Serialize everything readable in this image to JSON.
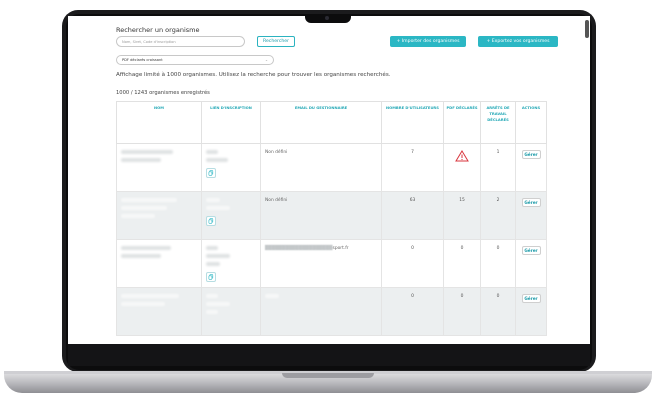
{
  "search": {
    "title": "Rechercher un organisme",
    "placeholder": "Nom, Siret, Code d'inscription",
    "button_label": "Rechercher"
  },
  "actions": {
    "import_label": "+ Importer des organismes",
    "export_label": "+ Exportez vos organismes"
  },
  "sort": {
    "selected": "PDF déclarés croissant"
  },
  "notice": "Affichage limité à 1000 organismes. Utilisez la recherche pour trouver les organismes recherchés.",
  "count": "1000 / 1243 organismes enregistrés",
  "table": {
    "headers": [
      "NOM",
      "LIEN D'INSCRIPTION",
      "EMAIL DU GESTIONNAIRE",
      "NOMBRE D'UTILISATEURS",
      "PDF DÉCLARÉS",
      "ARRÊTS DE TRAVAIL DÉCLARÉS",
      "ACTIONS"
    ],
    "rows": [
      {
        "email": "Non défini",
        "users": "7",
        "pdf": "",
        "pdf_warning": true,
        "arrets": "1",
        "action": "Gérer"
      },
      {
        "email": "Non défini",
        "users": "63",
        "pdf": "15",
        "pdf_warning": false,
        "arrets": "2",
        "action": "Gérer"
      },
      {
        "email": "sport.fr",
        "users": "0",
        "pdf": "0",
        "pdf_warning": false,
        "arrets": "0",
        "action": "Gérer"
      },
      {
        "email": "",
        "users": "0",
        "pdf": "0",
        "pdf_warning": false,
        "arrets": "0",
        "action": "Gérer"
      }
    ]
  },
  "icons": {
    "warning": "warning-triangle-icon",
    "copy": "copy-icon",
    "chevron": "chevron-down-icon"
  },
  "colors": {
    "accent": "#2bb7c4",
    "warning": "#d9363e",
    "row_shade": "#eceff0"
  }
}
